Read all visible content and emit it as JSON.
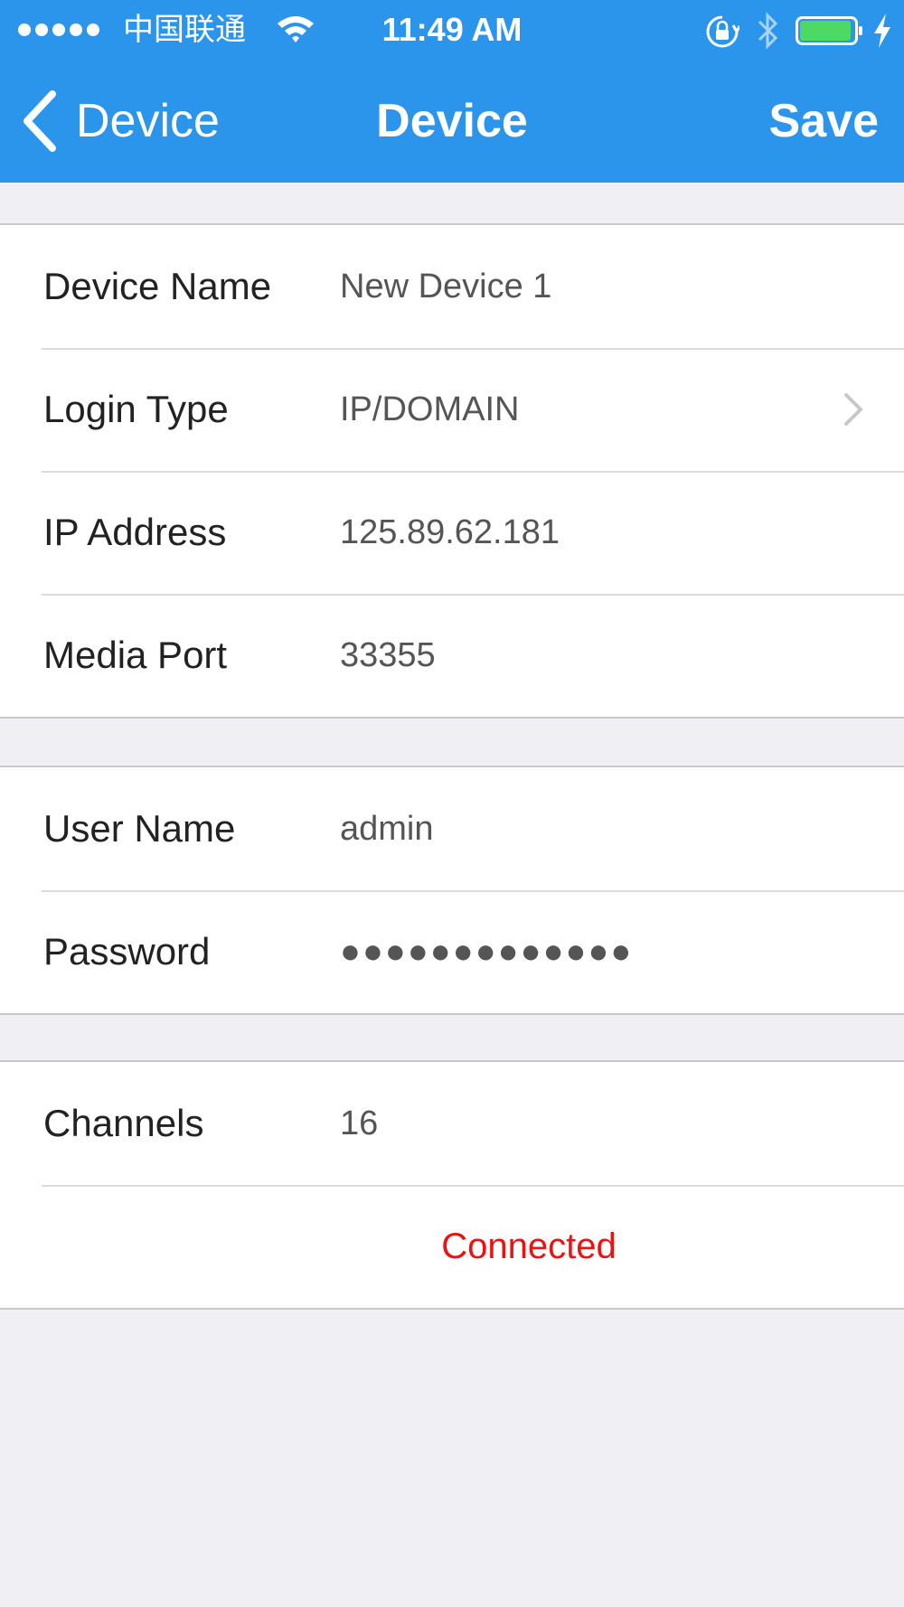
{
  "status_bar": {
    "carrier": "中国联通",
    "time": "11:49 AM"
  },
  "nav": {
    "back_label": "Device",
    "title": "Device",
    "save_label": "Save"
  },
  "groups": [
    {
      "rows": [
        {
          "label": "Device Name",
          "value": "New Device 1"
        },
        {
          "label": "Login Type",
          "value": "IP/DOMAIN"
        },
        {
          "label": "IP Address",
          "value": "125.89.62.181"
        },
        {
          "label": "Media Port",
          "value": "33355"
        }
      ]
    },
    {
      "rows": [
        {
          "label": "User Name",
          "value": "admin"
        },
        {
          "label": "Password",
          "value": "●●●●●●●●●●●●●"
        }
      ]
    },
    {
      "rows": [
        {
          "label": "Channels",
          "value": "16"
        }
      ],
      "status": "Connected"
    }
  ],
  "colors": {
    "header": "#2b95ec",
    "background": "#efeff4",
    "status_connected": "#f01010"
  }
}
